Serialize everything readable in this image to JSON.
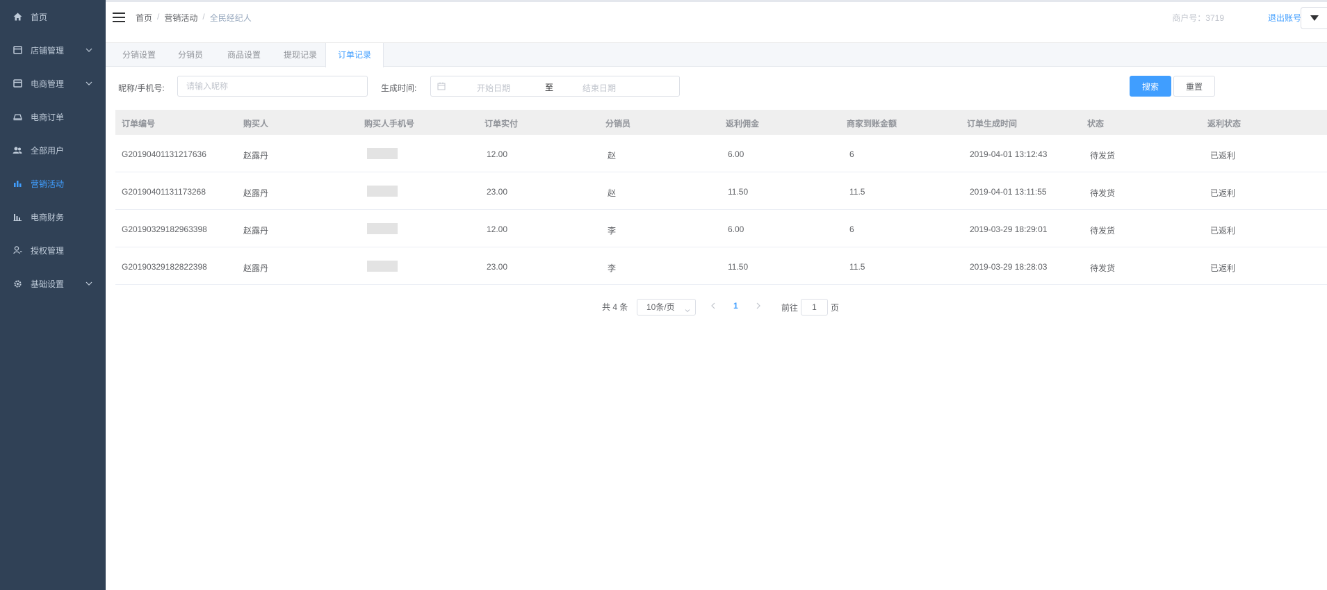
{
  "sidebar": {
    "items": [
      {
        "label": "首页",
        "icon": "home-icon"
      },
      {
        "label": "店铺管理",
        "icon": "store-icon",
        "expandable": true
      },
      {
        "label": "电商管理",
        "icon": "store-icon",
        "expandable": true
      },
      {
        "label": "电商订单",
        "icon": "order-icon"
      },
      {
        "label": "全部用户",
        "icon": "users-icon"
      },
      {
        "label": "营销活动",
        "icon": "chart-icon",
        "active": true
      },
      {
        "label": "电商财务",
        "icon": "finance-icon"
      },
      {
        "label": "授权管理",
        "icon": "user-key-icon"
      },
      {
        "label": "基础设置",
        "icon": "gear-icon",
        "expandable": true
      }
    ]
  },
  "header": {
    "breadcrumb": [
      "首页",
      "营销活动",
      "全民经纪人"
    ],
    "merchant": "商户号：3719",
    "logout": "退出账号"
  },
  "tabs": [
    "分销设置",
    "分销员",
    "商品设置",
    "提现记录",
    "订单记录"
  ],
  "active_tab": 4,
  "filter": {
    "name_label": "昵称/手机号:",
    "name_placeholder": "请输入昵称",
    "time_label": "生成时间:",
    "start_placeholder": "开始日期",
    "range_sep": "至",
    "end_placeholder": "结束日期",
    "search_btn": "搜索",
    "reset_btn": "重置"
  },
  "table": {
    "columns": [
      "订单编号",
      "购买人",
      "购买人手机号",
      "订单实付",
      "分销员",
      "返利佣金",
      "商家到账金额",
      "订单生成时间",
      "状态",
      "返利状态"
    ],
    "rows": [
      [
        "G20190401131217636",
        "赵露丹",
        "",
        "12.00",
        "赵",
        "6.00",
        "6",
        "2019-04-01 13:12:43",
        "待发货",
        "已返利"
      ],
      [
        "G20190401131173268",
        "赵露丹",
        "",
        "23.00",
        "赵",
        "11.50",
        "11.5",
        "2019-04-01 13:11:55",
        "待发货",
        "已返利"
      ],
      [
        "G20190329182963398",
        "赵露丹",
        "",
        "12.00",
        "李",
        "6.00",
        "6",
        "2019-03-29 18:29:01",
        "待发货",
        "已返利"
      ],
      [
        "G20190329182822398",
        "赵露丹",
        "",
        "23.00",
        "李",
        "11.50",
        "11.5",
        "2019-03-29 18:28:03",
        "待发货",
        "已返利"
      ]
    ]
  },
  "pagination": {
    "total": "共 4 条",
    "page_size": "10条/页",
    "current": "1",
    "goto_label": "前往",
    "goto_value": "1",
    "page_unit": "页"
  },
  "colors": {
    "sidebar_bg": "#304156",
    "accent": "#409eff"
  }
}
